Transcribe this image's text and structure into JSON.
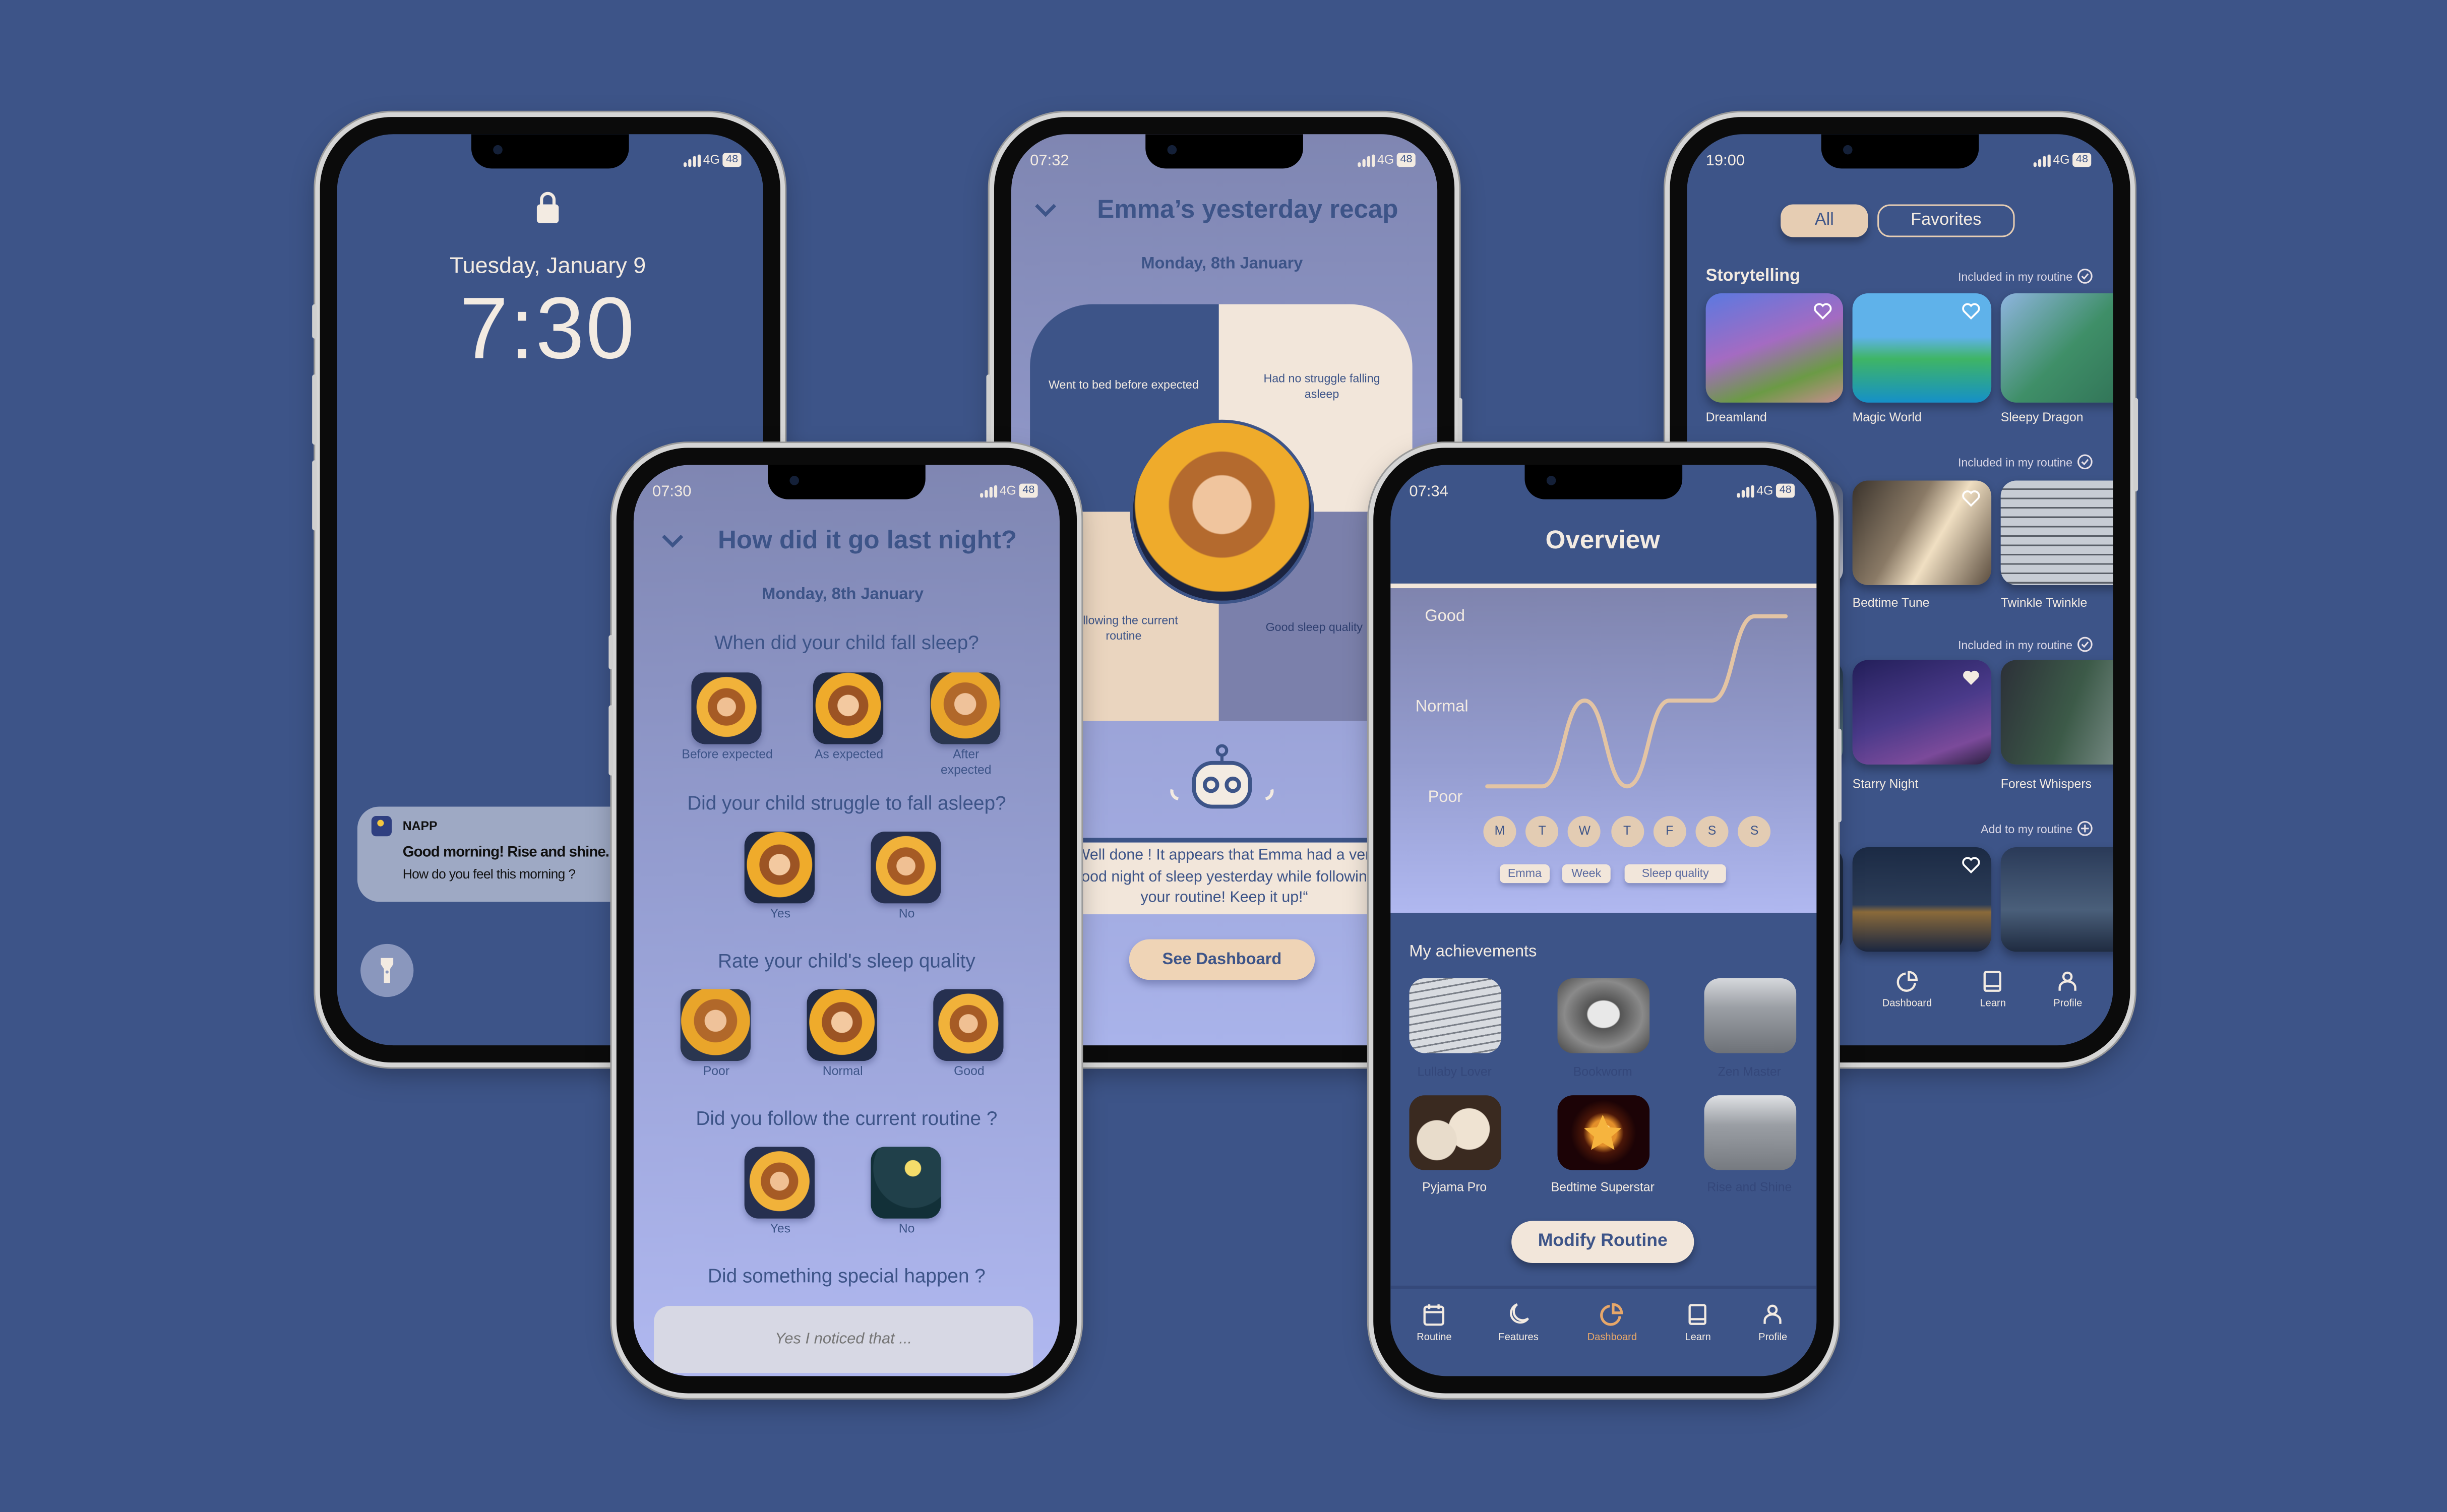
{
  "colors": {
    "background": "#3d5488",
    "navy": "#3d5488",
    "cream": "#f2e6da",
    "peach": "#e6cdb3",
    "accent": "#e7a769",
    "lavender": "#a9b3ea"
  },
  "lock_screen": {
    "status": {
      "network": "4G",
      "battery": "48"
    },
    "date": "Tuesday, January 9",
    "time": "7:30",
    "notification": {
      "app": "NAPP",
      "title": "Good morning! Rise and shine.",
      "body": "How do you feel this morning ?"
    },
    "icons": [
      "lock-icon",
      "flashlight-icon",
      "app-icon"
    ]
  },
  "recap": {
    "status": {
      "time": "07:32",
      "network": "4G",
      "battery": "48"
    },
    "title": "Emma’s yesterday recap",
    "date": "Monday, 8th January",
    "tiles": [
      "Went to bed before expected",
      "Had no struggle falling asleep",
      "Following the current routine",
      "Good sleep quality"
    ],
    "message_lines": [
      "“Well done ! It appears that Emma had a very",
      "good night of sleep yesterday while following",
      "your routine! Keep it up!“"
    ],
    "button": "See Dashboard"
  },
  "features": {
    "status": {
      "time": "19:00",
      "network": "4G",
      "battery": "48"
    },
    "tabs": [
      {
        "label": "All",
        "active": true
      },
      {
        "label": "Favorites",
        "active": false
      }
    ],
    "sections": [
      {
        "title": "Storytelling",
        "status": "Included in my routine",
        "status_icon": "check-circle-icon",
        "items": [
          "Dreamland",
          "Magic World",
          "Sleepy Dragon"
        ]
      },
      {
        "status": "Included in my routine",
        "status_icon": "check-circle-icon",
        "items": [
          "Bedtime Tune",
          "Twinkle Twinkle"
        ]
      },
      {
        "status": "Included in my routine",
        "status_icon": "check-circle-icon",
        "items": [
          "Starry Night",
          "Forest Whispers"
        ]
      },
      {
        "status": "Add to my routine",
        "status_icon": "plus-circle-icon",
        "items": []
      }
    ],
    "nav": [
      {
        "label": "Dashboard",
        "icon": "pie-chart-icon"
      },
      {
        "label": "Learn",
        "icon": "book-icon"
      },
      {
        "label": "Profile",
        "icon": "user-icon"
      }
    ]
  },
  "checkin": {
    "status": {
      "time": "07:30",
      "network": "4G",
      "battery": "48"
    },
    "title": "How did it go last night?",
    "date": "Monday, 8th January",
    "questions": [
      {
        "question": "When did your child fall sleep?",
        "options": [
          "Before expected",
          "As expected",
          "After expected"
        ]
      },
      {
        "question": "Did your child struggle to fall asleep?",
        "options": [
          "Yes",
          "No"
        ]
      },
      {
        "question": "Rate your child's sleep quality",
        "options": [
          "Poor",
          "Normal",
          "Good"
        ]
      },
      {
        "question": "Did you follow the current routine ?",
        "options": [
          "Yes",
          "No"
        ]
      },
      {
        "question": "Did something special happen ?"
      }
    ],
    "input_placeholder": "Yes I noticed that ..."
  },
  "overview": {
    "status": {
      "time": "07:34",
      "network": "4G",
      "battery": "48"
    },
    "title": "Overview",
    "filters": [
      "Emma",
      "Week",
      "Sleep quality"
    ],
    "achievements_title": "My achievements",
    "achievements": [
      {
        "name": "Lullaby Lover",
        "unlocked": false
      },
      {
        "name": "Bookworm",
        "unlocked": false
      },
      {
        "name": "Zen Master",
        "unlocked": false
      },
      {
        "name": "Pyjama Pro",
        "unlocked": true
      },
      {
        "name": "Bedtime Superstar",
        "unlocked": true
      },
      {
        "name": "Rise and Shine",
        "unlocked": false
      }
    ],
    "button": "Modify Routine",
    "nav": [
      {
        "label": "Routine",
        "icon": "calendar-icon",
        "active": false
      },
      {
        "label": "Features",
        "icon": "moon-icon",
        "active": false
      },
      {
        "label": "Dashboard",
        "icon": "pie-chart-icon",
        "active": true
      },
      {
        "label": "Learn",
        "icon": "book-icon",
        "active": false
      },
      {
        "label": "Profile",
        "icon": "user-icon",
        "active": false
      }
    ]
  },
  "chart_data": {
    "type": "line",
    "categories": [
      "M",
      "T",
      "W",
      "T",
      "F",
      "S",
      "S"
    ],
    "y_levels": [
      "Poor",
      "Normal",
      "Good"
    ],
    "values": [
      "Poor",
      "Poor",
      "Normal",
      "Poor",
      "Normal",
      "Normal",
      "Good"
    ],
    "line_color": "#e3c4a4",
    "grid": false
  }
}
